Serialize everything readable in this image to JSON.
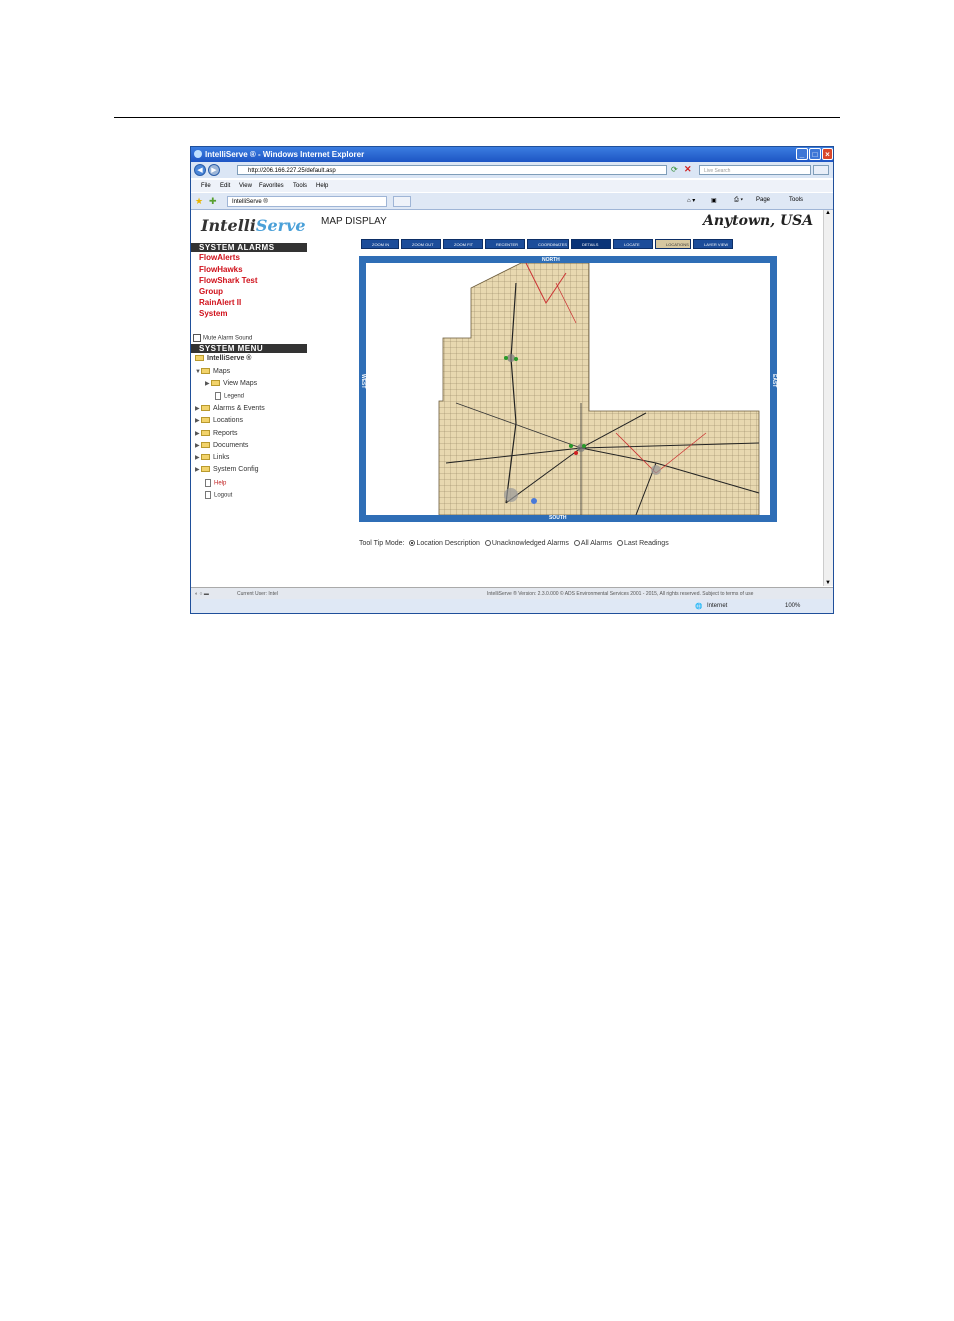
{
  "window": {
    "title": "IntelliServe ® - Windows Internet Explorer",
    "url": "http://206.166.227.25/default.asp",
    "search_placeholder": "Live Search",
    "menu": [
      "File",
      "Edit",
      "View",
      "Favorites",
      "Tools",
      "Help"
    ],
    "tab_label": "IntelliServe ®",
    "toolbar_page": "Page",
    "toolbar_tools": "Tools"
  },
  "app": {
    "logo_part1": "Intelli",
    "logo_part2": "Serve",
    "page_title": "MAP DISPLAY",
    "location_title": "Anytown, USA"
  },
  "sidebar": {
    "alarms_header": "SYSTEM ALARMS",
    "alarms": [
      "FlowAlerts",
      "FlowHawks",
      "FlowShark Test",
      "Group",
      "RainAlert II",
      "System"
    ],
    "mute_label": "Mute Alarm Sound",
    "menu_header": "SYSTEM MENU",
    "root": "IntelliServe ®",
    "tree": {
      "maps": "Maps",
      "view_maps": "View Maps",
      "legend": "Legend",
      "alarms_events": "Alarms & Events",
      "locations": "Locations",
      "reports": "Reports",
      "documents": "Documents",
      "links": "Links",
      "system_config": "System Config",
      "help": "Help",
      "logout": "Logout"
    }
  },
  "map_toolbar": [
    "ZOOM IN",
    "ZOOM OUT",
    "ZOOM FIT",
    "RECENTER",
    "COORDINATES",
    "DETAILS",
    "LOCATE",
    "LOCATIONS",
    "LAYER VIEW"
  ],
  "map": {
    "north": "NORTH",
    "south": "SOUTH",
    "west": "WEST",
    "east": "EAST"
  },
  "tooltip_mode": {
    "label": "Tool Tip Mode:",
    "options": [
      "Location Description",
      "Unacknowledged Alarms",
      "All Alarms",
      "Last Readings"
    ],
    "selected": "Location Description"
  },
  "status": {
    "current_user": "Current User: Intel",
    "footer": "IntelliServe ® Version: 2.3.0.000 © ADS Environmental Services 2001 - 2015, All rights reserved. Subject to terms of use",
    "zone": "Internet",
    "zoom": "100%"
  }
}
